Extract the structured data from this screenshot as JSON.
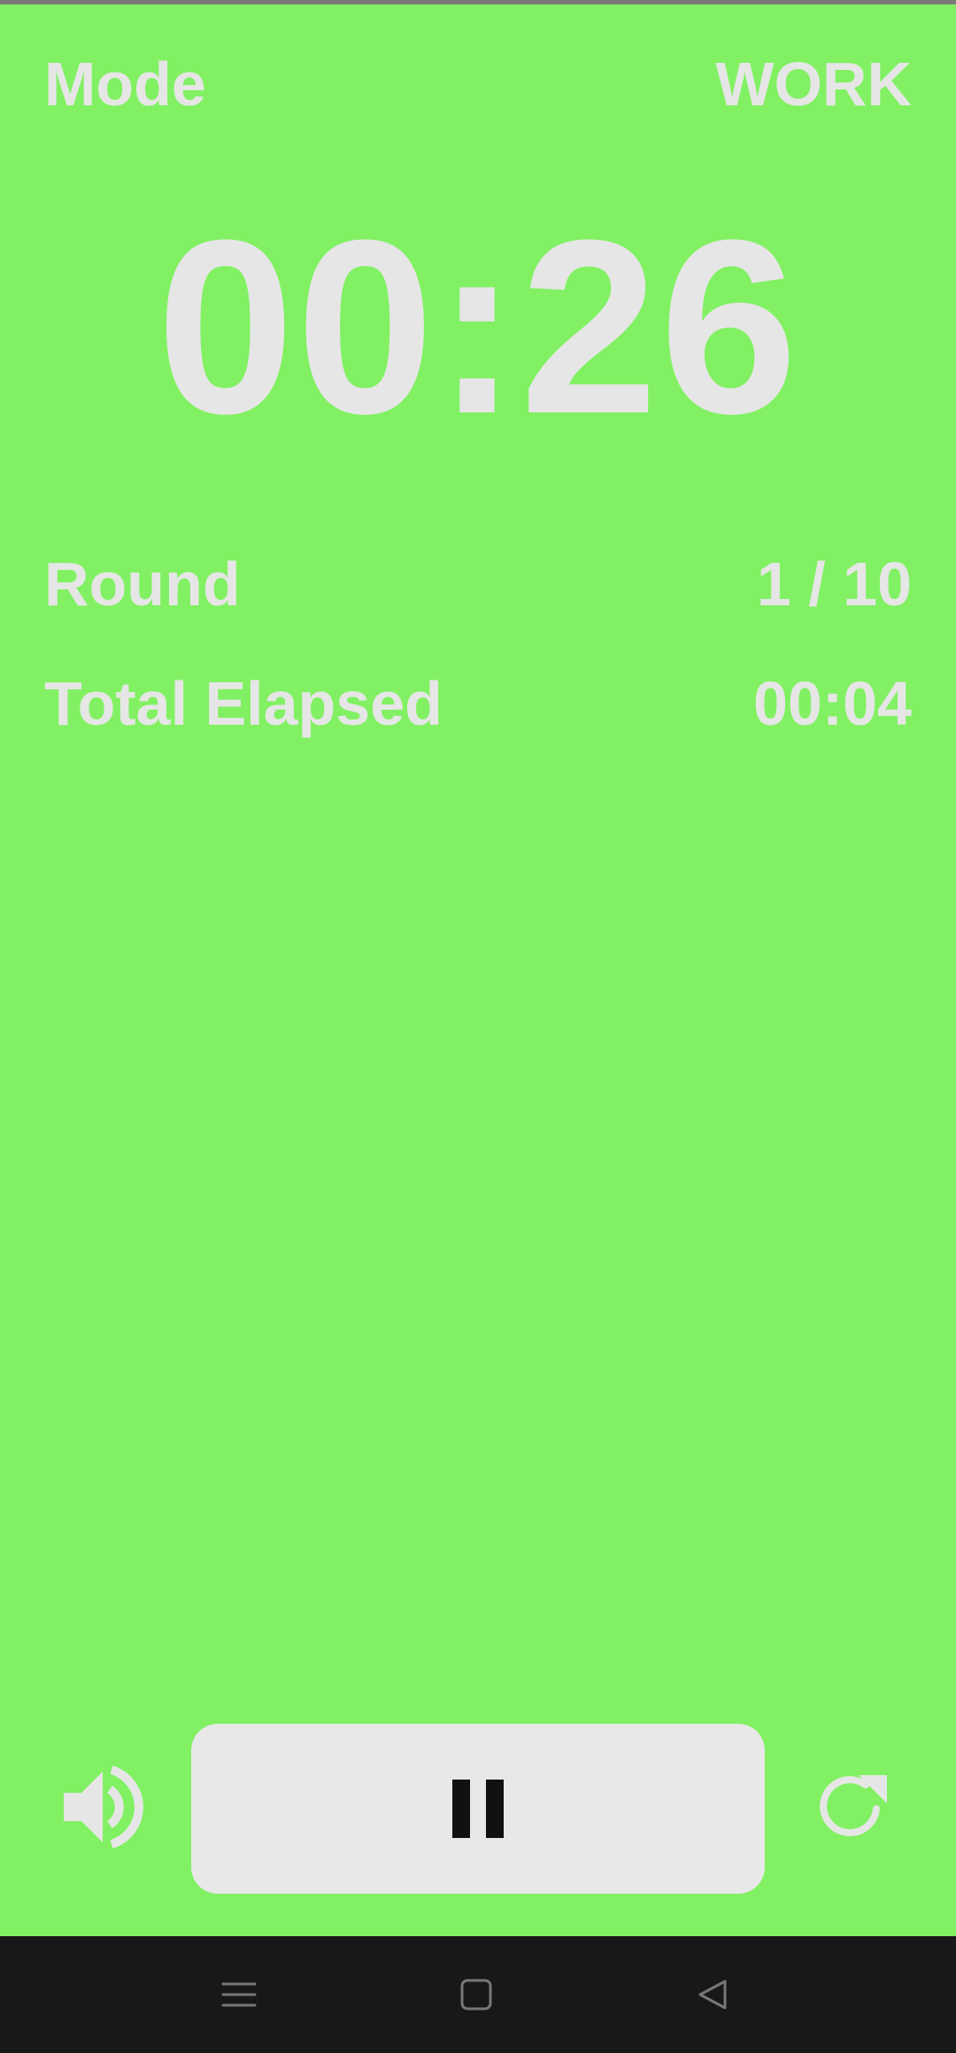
{
  "mode": {
    "label": "Mode",
    "value": "WORK"
  },
  "timer": {
    "display": "00:26"
  },
  "round": {
    "label": "Round",
    "value": "1 / 10"
  },
  "elapsed": {
    "label": "Total Elapsed",
    "value": "00:04"
  },
  "controls": {
    "sound_icon": "volume-up-icon",
    "primary_icon": "pause-icon",
    "restart_icon": "restart-icon"
  },
  "navigation": {
    "items": [
      {
        "icon": "menu-icon"
      },
      {
        "icon": "home-icon"
      },
      {
        "icon": "back-icon"
      }
    ]
  },
  "colors": {
    "background": "#81f163",
    "text": "#e6e6e6",
    "button": "#e8e8e8",
    "nav_bar": "#181818"
  }
}
